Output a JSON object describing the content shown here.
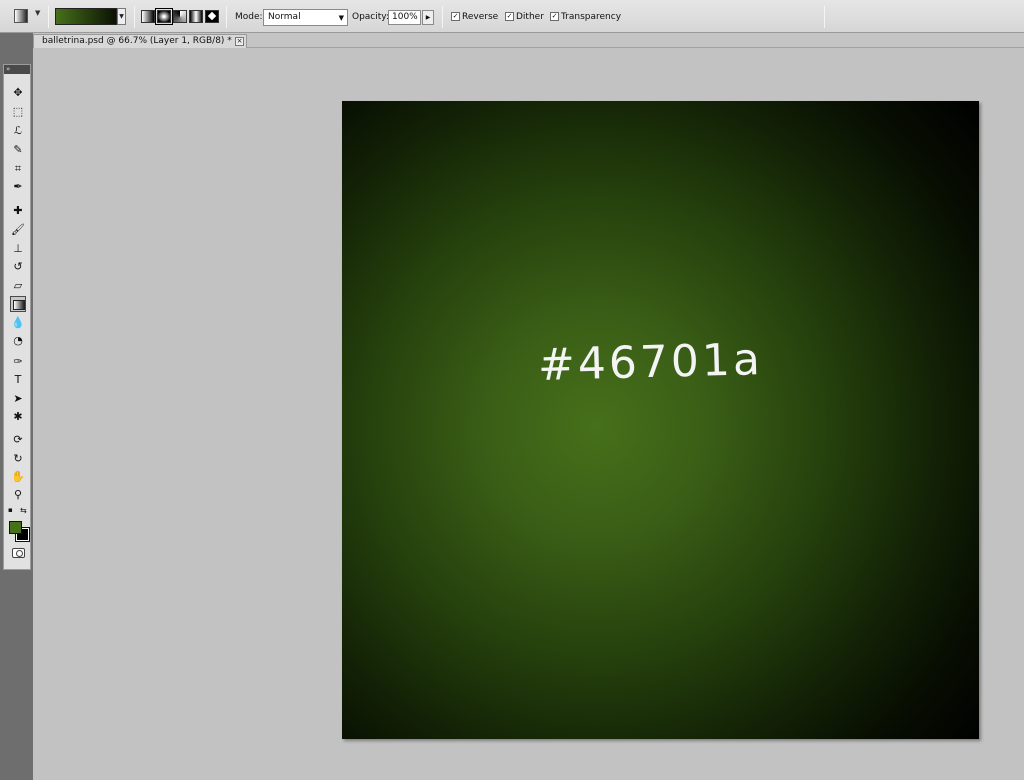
{
  "options_bar": {
    "mode_label": "Mode:",
    "mode_value": "Normal",
    "opacity_label": "Opacity:",
    "opacity_value": "100%",
    "reverse_label": "Reverse",
    "reverse_checked": true,
    "dither_label": "Dither",
    "dither_checked": true,
    "transparency_label": "Transparency",
    "transparency_checked": true,
    "gradient_colors": [
      "#46701a",
      "#000000"
    ],
    "gradient_types": [
      "linear",
      "radial",
      "angle",
      "reflected",
      "diamond"
    ],
    "selected_gradient_type": "radial"
  },
  "document": {
    "tab_title": "balletrina.psd @ 66.7% (Layer 1, RGB/8) *",
    "close_glyph": "×",
    "canvas_text": "#46701a",
    "canvas_gradient_colors": [
      "#46701a",
      "#000000"
    ]
  },
  "toolbox": {
    "header_glyph": "»",
    "tools": [
      {
        "name": "move-tool",
        "glyph": "✥"
      },
      {
        "name": "marquee-tool",
        "glyph": "⬚"
      },
      {
        "name": "lasso-tool",
        "glyph": "ℒ"
      },
      {
        "name": "quick-selection-tool",
        "glyph": "✎"
      },
      {
        "name": "crop-tool",
        "glyph": "⌗"
      },
      {
        "name": "eyedropper-tool",
        "glyph": "✒"
      },
      {
        "name": "healing-brush-tool",
        "glyph": "✚"
      },
      {
        "name": "brush-tool",
        "glyph": "🖌"
      },
      {
        "name": "clone-stamp-tool",
        "glyph": "⊥"
      },
      {
        "name": "history-brush-tool",
        "glyph": "↺"
      },
      {
        "name": "eraser-tool",
        "glyph": "▱"
      },
      {
        "name": "gradient-tool",
        "glyph": "▤"
      },
      {
        "name": "blur-tool",
        "glyph": "💧"
      },
      {
        "name": "dodge-tool",
        "glyph": "◔"
      },
      {
        "name": "pen-tool",
        "glyph": "✑"
      },
      {
        "name": "type-tool",
        "glyph": "T"
      },
      {
        "name": "path-selection-tool",
        "glyph": "➤"
      },
      {
        "name": "shape-tool",
        "glyph": "✱"
      },
      {
        "name": "3d-rotate-tool",
        "glyph": "⟳"
      },
      {
        "name": "3d-orbit-tool",
        "glyph": "↻"
      },
      {
        "name": "hand-tool",
        "glyph": "✋"
      },
      {
        "name": "zoom-tool",
        "glyph": "⚲"
      }
    ],
    "active_tool": "gradient-tool",
    "foreground_color": "#46701a",
    "background_color": "#000000"
  }
}
